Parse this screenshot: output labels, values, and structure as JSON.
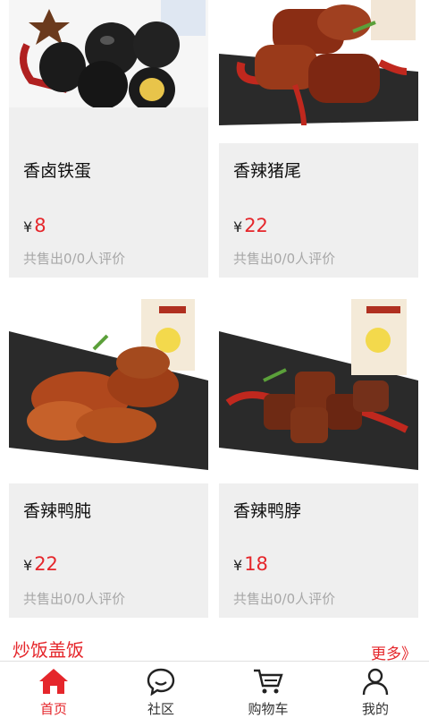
{
  "products": [
    {
      "name": "香卤铁蛋",
      "currency": "¥",
      "price": "8",
      "sold": "共售出0/0人评价"
    },
    {
      "name": "香辣猪尾",
      "currency": "¥",
      "price": "22",
      "sold": "共售出0/0人评价"
    },
    {
      "name": "香辣鸭肫",
      "currency": "¥",
      "price": "22",
      "sold": "共售出0/0人评价"
    },
    {
      "name": "香辣鸭脖",
      "currency": "¥",
      "price": "18",
      "sold": "共售出0/0人评价"
    }
  ],
  "section": {
    "title": "炒饭盖饭",
    "more": "更多》"
  },
  "tabbar": {
    "items": [
      {
        "label": "首页",
        "icon": "home-icon"
      },
      {
        "label": "社区",
        "icon": "chat-icon"
      },
      {
        "label": "购物车",
        "icon": "cart-icon"
      },
      {
        "label": "我的",
        "icon": "user-icon"
      }
    ]
  },
  "colors": {
    "accent": "#e5262b",
    "card_bg": "#efefef"
  }
}
